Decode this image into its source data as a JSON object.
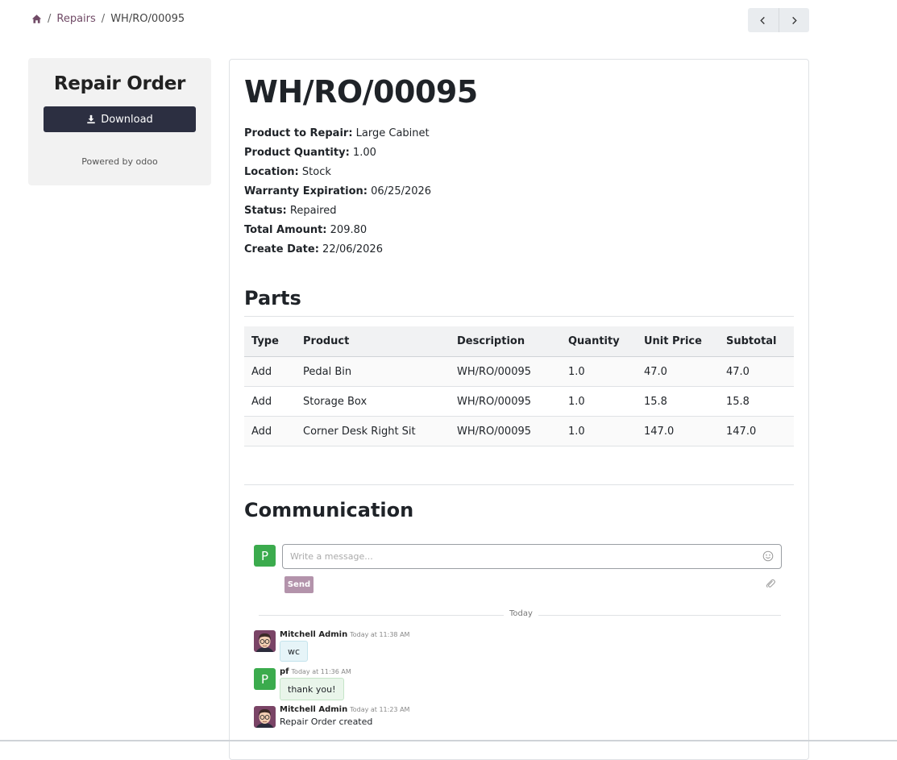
{
  "breadcrumb": {
    "icon": "home-icon",
    "items": [
      "Repairs",
      "WH/RO/00095"
    ]
  },
  "pager": {
    "prev_icon": "chevron-left-icon",
    "next_icon": "chevron-right-icon"
  },
  "sidebar": {
    "title": "Repair Order",
    "download_label": "Download",
    "download_icon": "download-icon",
    "powered_by": "Powered by odoo"
  },
  "order": {
    "name": "WH/RO/00095",
    "fields": [
      {
        "label": "Product to Repair:",
        "value": "Large Cabinet"
      },
      {
        "label": "Product Quantity:",
        "value": "1.00"
      },
      {
        "label": "Location:",
        "value": "Stock"
      },
      {
        "label": "Warranty Expiration:",
        "value": "06/25/2026"
      },
      {
        "label": "Status:",
        "value": "Repaired"
      },
      {
        "label": "Total Amount:",
        "value": "209.80"
      },
      {
        "label": "Create Date:",
        "value": "22/06/2026"
      }
    ]
  },
  "parts": {
    "heading": "Parts",
    "columns": [
      "Type",
      "Product",
      "Description",
      "Quantity",
      "Unit Price",
      "Subtotal"
    ],
    "rows": [
      [
        "Add",
        "Pedal Bin",
        "WH/RO/00095",
        "1.0",
        "47.0",
        "47.0"
      ],
      [
        "Add",
        "Storage Box",
        "WH/RO/00095",
        "1.0",
        "15.8",
        "15.8"
      ],
      [
        "Add",
        "Corner Desk Right Sit",
        "WH/RO/00095",
        "1.0",
        "147.0",
        "147.0"
      ]
    ]
  },
  "communication": {
    "heading": "Communication",
    "user_initial": "P",
    "placeholder": "Write a message...",
    "send_label": "Send",
    "divider_label": "Today",
    "messages": [
      {
        "author": "Mitchell Admin",
        "time": "Today at 11:38 AM",
        "body": "wc"
      },
      {
        "author": "pf",
        "time": "Today at 11:36 AM",
        "body": "thank you!",
        "initial": "P"
      },
      {
        "author": "Mitchell Admin",
        "time": "Today at 11:23 AM",
        "body": "Repair Order created"
      }
    ]
  },
  "colors": {
    "brand": "#714b67",
    "dark_button": "#2c2f41",
    "avatar_green": "#3bab4d",
    "send_button": "#b393ab"
  }
}
